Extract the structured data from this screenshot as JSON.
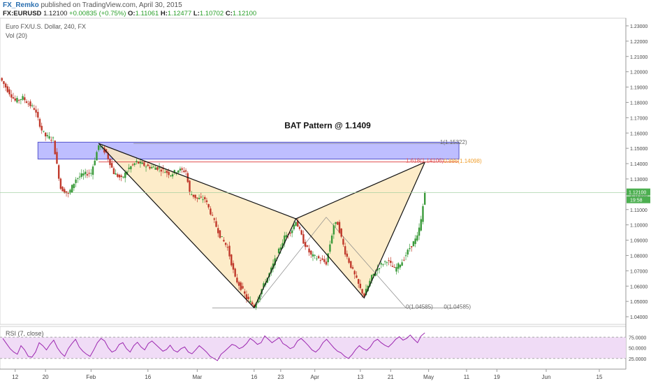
{
  "header": {
    "author": "FX_Remko",
    "published_text": "published on TradingView.com, April 30, 2015",
    "symbol": "FX:EURUSD",
    "last": "1.12100",
    "change": "+0.00835 (+0.75%)",
    "o_label": "O:",
    "o": "1.11061",
    "h_label": "H:",
    "h": "1.12477",
    "l_label": "L:",
    "l": "1.10702",
    "c_label": "C:",
    "c": "1.12100"
  },
  "pane_info": {
    "instrument": "Euro FX/U.S. Dollar, 240, FX",
    "volume": "Vol (20)",
    "rsi": "RSI (7, close)"
  },
  "colors": {
    "up": "#3a9a3a",
    "down": "#c0392b",
    "zone": "#8888ff",
    "pattern_fill": "#fde9c0",
    "rsi_fill": "#f0dcf6",
    "rsi_line": "#9c27b0",
    "fib_red": "#e05050",
    "fib_orange": "#f0a030",
    "price_tag": "#4caf50"
  },
  "chart_data": {
    "type": "candlestick",
    "title": "BAT Pattern @ 1.1409",
    "price_axis": {
      "ylim": [
        1.035,
        1.235
      ],
      "ticks": [
        "1.23000",
        "1.22000",
        "1.21000",
        "1.20000",
        "1.19000",
        "1.18000",
        "1.17000",
        "1.16000",
        "1.15000",
        "1.14000",
        "1.13000",
        "1.12000",
        "1.11000",
        "1.10000",
        "1.09000",
        "1.08000",
        "1.07000",
        "1.06000",
        "1.05000",
        "1.04000"
      ]
    },
    "x_ticks": [
      {
        "label": "12",
        "date": "2015-01-12"
      },
      {
        "label": "20",
        "date": "2015-01-20"
      },
      {
        "label": "Feb",
        "date": "2015-02-01"
      },
      {
        "label": "16",
        "date": "2015-02-16"
      },
      {
        "label": "Mar",
        "date": "2015-03-01"
      },
      {
        "label": "16",
        "date": "2015-03-16"
      },
      {
        "label": "23",
        "date": "2015-03-23"
      },
      {
        "label": "Apr",
        "date": "2015-04-01"
      },
      {
        "label": "13",
        "date": "2015-04-13"
      },
      {
        "label": "21",
        "date": "2015-04-21"
      },
      {
        "label": "May",
        "date": "2015-05-01"
      },
      {
        "label": "11",
        "date": "2015-05-11"
      },
      {
        "label": "19",
        "date": "2015-05-19"
      },
      {
        "label": "Jun",
        "date": "2015-06-01"
      },
      {
        "label": "15",
        "date": "2015-06-15"
      }
    ],
    "x_range": [
      "2015-01-08",
      "2015-06-22"
    ],
    "price_path": [
      [
        "2015-01-08",
        1.196
      ],
      [
        "2015-01-10",
        1.188
      ],
      [
        "2015-01-12",
        1.181
      ],
      [
        "2015-01-14",
        1.183
      ],
      [
        "2015-01-16",
        1.178
      ],
      [
        "2015-01-17",
        1.176
      ],
      [
        "2015-01-19",
        1.162
      ],
      [
        "2015-01-20",
        1.158
      ],
      [
        "2015-01-22",
        1.156
      ],
      [
        "2015-01-23",
        1.139
      ],
      [
        "2015-01-24",
        1.124
      ],
      [
        "2015-01-26",
        1.12
      ],
      [
        "2015-01-28",
        1.13
      ],
      [
        "2015-01-30",
        1.133
      ],
      [
        "2015-02-01",
        1.134
      ],
      [
        "2015-02-03",
        1.152
      ],
      [
        "2015-02-05",
        1.147
      ],
      [
        "2015-02-07",
        1.134
      ],
      [
        "2015-02-09",
        1.13
      ],
      [
        "2015-02-11",
        1.137
      ],
      [
        "2015-02-13",
        1.141
      ],
      [
        "2015-02-16",
        1.138
      ],
      [
        "2015-02-19",
        1.137
      ],
      [
        "2015-02-22",
        1.133
      ],
      [
        "2015-02-24",
        1.136
      ],
      [
        "2015-02-26",
        1.135
      ],
      [
        "2015-02-27",
        1.121
      ],
      [
        "2015-03-01",
        1.117
      ],
      [
        "2015-03-03",
        1.117
      ],
      [
        "2015-03-05",
        1.105
      ],
      [
        "2015-03-07",
        1.093
      ],
      [
        "2015-03-09",
        1.085
      ],
      [
        "2015-03-11",
        1.065
      ],
      [
        "2015-03-13",
        1.057
      ],
      [
        "2015-03-14",
        1.052
      ],
      [
        "2015-03-16",
        1.047
      ],
      [
        "2015-03-18",
        1.058
      ],
      [
        "2015-03-20",
        1.068
      ],
      [
        "2015-03-22",
        1.08
      ],
      [
        "2015-03-24",
        1.092
      ],
      [
        "2015-03-26",
        1.097
      ],
      [
        "2015-03-27",
        1.103
      ],
      [
        "2015-03-29",
        1.089
      ],
      [
        "2015-03-31",
        1.08
      ],
      [
        "2015-04-02",
        1.078
      ],
      [
        "2015-04-04",
        1.075
      ],
      [
        "2015-04-06",
        1.1
      ],
      [
        "2015-04-07",
        1.101
      ],
      [
        "2015-04-09",
        1.082
      ],
      [
        "2015-04-11",
        1.07
      ],
      [
        "2015-04-13",
        1.058
      ],
      [
        "2015-04-14",
        1.054
      ],
      [
        "2015-04-16",
        1.066
      ],
      [
        "2015-04-18",
        1.073
      ],
      [
        "2015-04-20",
        1.077
      ],
      [
        "2015-04-22",
        1.071
      ],
      [
        "2015-04-24",
        1.076
      ],
      [
        "2015-04-26",
        1.085
      ],
      [
        "2015-04-28",
        1.092
      ],
      [
        "2015-04-29",
        1.103
      ],
      [
        "2015-04-30",
        1.121
      ]
    ],
    "last_price": "1.12100",
    "countdown": "19:58",
    "bat_pattern": {
      "X": [
        "2015-02-03",
        1.1532
      ],
      "A": [
        "2015-03-16",
        1.0458
      ],
      "B": [
        "2015-03-27",
        1.104
      ],
      "C": [
        "2015-04-14",
        1.0523
      ],
      "D": [
        "2015-04-30",
        1.1409
      ]
    },
    "resistance_zone": {
      "top": 1.154,
      "bottom": 1.143,
      "from": "2015-01-18",
      "to": "2015-05-09"
    },
    "annotations": [
      {
        "text": "1(1.15322)",
        "date": "2015-05-04",
        "price": 1.1532
      },
      {
        "text": "1.618(1.14106)",
        "date": "2015-04-25",
        "price": 1.1411
      },
      {
        "text": "0.886(1.14098)",
        "date": "2015-05-05",
        "price": 1.141
      },
      {
        "text": "0(1.04585)",
        "date": "2015-04-25",
        "price": 1.0458
      },
      {
        "text": "0(1.04585)",
        "date": "2015-05-05",
        "price": 1.0458
      }
    ],
    "rsi": {
      "levels": [
        75,
        25
      ],
      "ticks": [
        "75.0000",
        "50.0000",
        "25.0000"
      ],
      "values": [
        72,
        60,
        48,
        40,
        35,
        55,
        45,
        30,
        28,
        40,
        62,
        55,
        45,
        58,
        68,
        50,
        38,
        30,
        48,
        60,
        70,
        52,
        42,
        35,
        30,
        45,
        62,
        72,
        66,
        50,
        40,
        44,
        58,
        62,
        48,
        40,
        55,
        63,
        52,
        45,
        60,
        66,
        58,
        50,
        42,
        46,
        56,
        44,
        40,
        48,
        52,
        40,
        36,
        45,
        55,
        48,
        40,
        30,
        25,
        20,
        35,
        42,
        50,
        58,
        55,
        48,
        52,
        60,
        72,
        66,
        58,
        62,
        78,
        70,
        62,
        68,
        74,
        60,
        55,
        48,
        52,
        66,
        72,
        64,
        55,
        45,
        40,
        48,
        62,
        70,
        60,
        50,
        42,
        38,
        30,
        25,
        34,
        46,
        55,
        48,
        44,
        52,
        65,
        70,
        62,
        56,
        52,
        60,
        70,
        76,
        68,
        72,
        80,
        70,
        62,
        78,
        85
      ]
    }
  }
}
